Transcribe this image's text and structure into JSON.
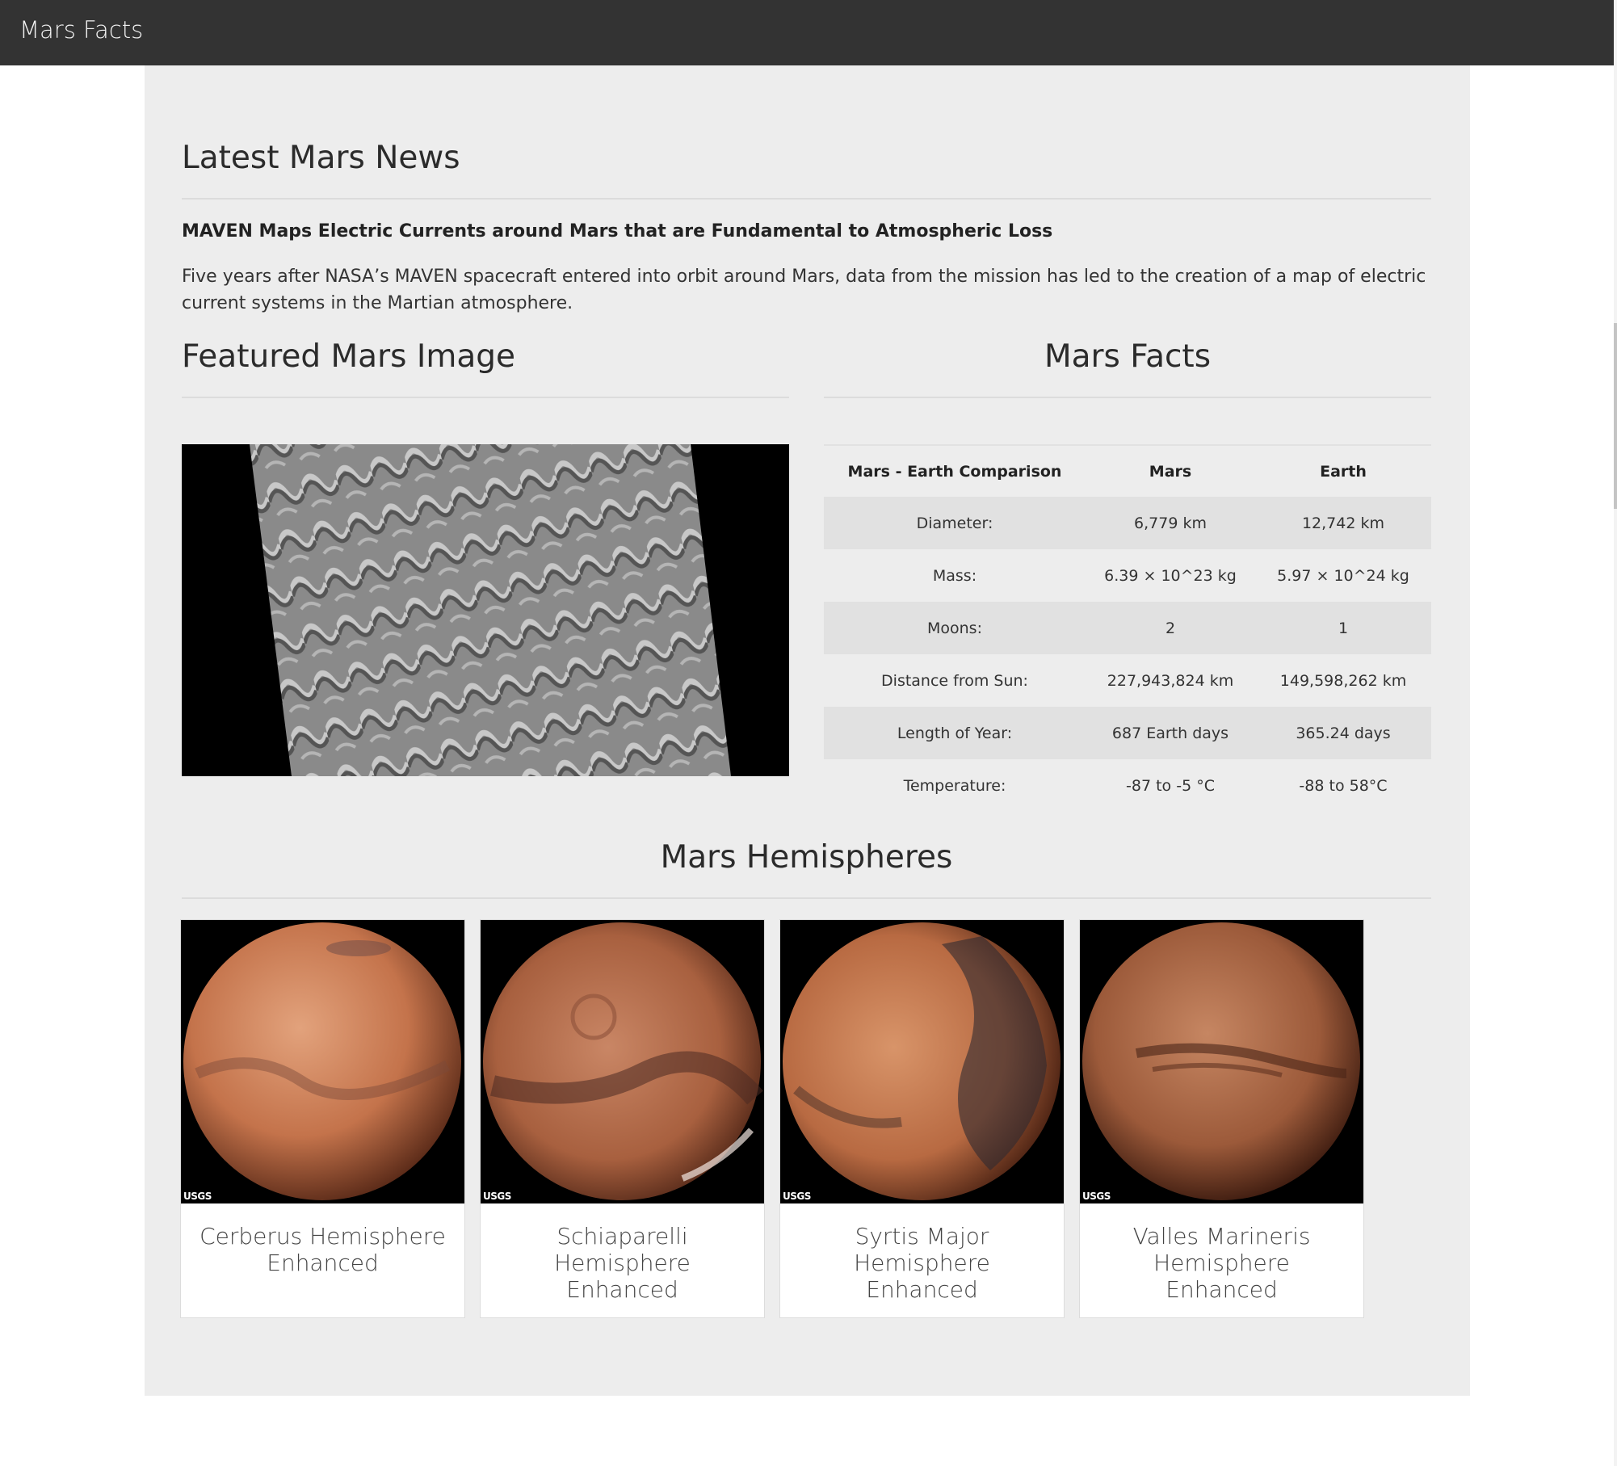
{
  "navbar": {
    "brand": "Mars Facts"
  },
  "news": {
    "heading": "Latest Mars News",
    "title": "MAVEN Maps Electric Currents around Mars that are Fundamental to Atmospheric Loss",
    "body": "Five years after NASA’s MAVEN spacecraft entered into orbit around Mars, data from the mission has led to the creation of a map of electric current systems in the Martian atmosphere."
  },
  "featured": {
    "heading": "Featured Mars Image"
  },
  "facts": {
    "heading": "Mars Facts",
    "columns": [
      "Mars - Earth Comparison",
      "Mars",
      "Earth"
    ],
    "rows": [
      [
        "Diameter:",
        "6,779 km",
        "12,742 km"
      ],
      [
        "Mass:",
        "6.39 × 10^23 kg",
        "5.97 × 10^24 kg"
      ],
      [
        "Moons:",
        "2",
        "1"
      ],
      [
        "Distance from Sun:",
        "227,943,824 km",
        "149,598,262 km"
      ],
      [
        "Length of Year:",
        "687 Earth days",
        "365.24 days"
      ],
      [
        "Temperature:",
        "-87 to -5 °C",
        "-88 to 58°C"
      ]
    ]
  },
  "hemispheres": {
    "heading": "Mars Hemispheres",
    "watermark": "USGS",
    "items": [
      {
        "title": "Cerberus Hemisphere Enhanced"
      },
      {
        "title": "Schiaparelli Hemisphere Enhanced"
      },
      {
        "title": "Syrtis Major Hemisphere Enhanced"
      },
      {
        "title": "Valles Marineris Hemisphere Enhanced"
      }
    ]
  },
  "colors": {
    "navbar": "#333333",
    "container": "#ededed",
    "table_stripe": "#e1e1e1",
    "mars_light": "#d88a61",
    "mars_dark": "#6e3a26"
  }
}
